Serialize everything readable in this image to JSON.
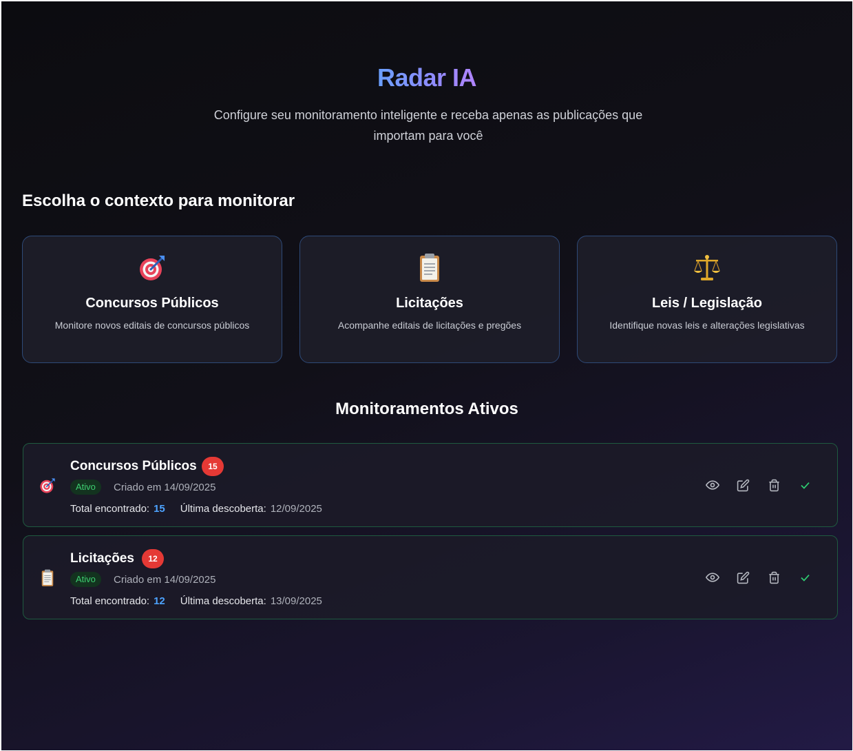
{
  "header": {
    "title": "Radar IA",
    "subtitle_line1": "Configure seu monitoramento inteligente e receba apenas as publicações que",
    "subtitle_line2": "importam para você"
  },
  "contexts": {
    "heading": "Escolha o contexto para monitorar",
    "cards": [
      {
        "icon": "target-icon",
        "title": "Concursos Públicos",
        "description": "Monitore novos editais de concursos públicos"
      },
      {
        "icon": "clipboard-icon",
        "title": "Licitações",
        "description": "Acompanhe editais de licitações e pregões"
      },
      {
        "icon": "scales-icon",
        "title": "Leis / Legislação",
        "description": "Identifique novas leis e alterações legislativas"
      }
    ]
  },
  "monitors": {
    "heading": "Monitoramentos Ativos",
    "total_label": "Total encontrado:",
    "last_label": "Última descoberta:",
    "items": [
      {
        "icon": "target-icon",
        "title": "Concursos Públicos",
        "count": "15",
        "status": "Ativo",
        "created": "Criado em 14/09/2025",
        "total": "15",
        "last": "12/09/2025"
      },
      {
        "icon": "clipboard-icon",
        "title": "Licitações",
        "count": "12",
        "status": "Ativo",
        "created": "Criado em 14/09/2025",
        "total": "12",
        "last": "13/09/2025"
      }
    ]
  },
  "colors": {
    "accent_blue": "#4da3ff",
    "badge_red": "#e53935",
    "status_green": "#3ecf72",
    "card_border": "#2e4a78",
    "monitor_border": "#1f5b40"
  }
}
